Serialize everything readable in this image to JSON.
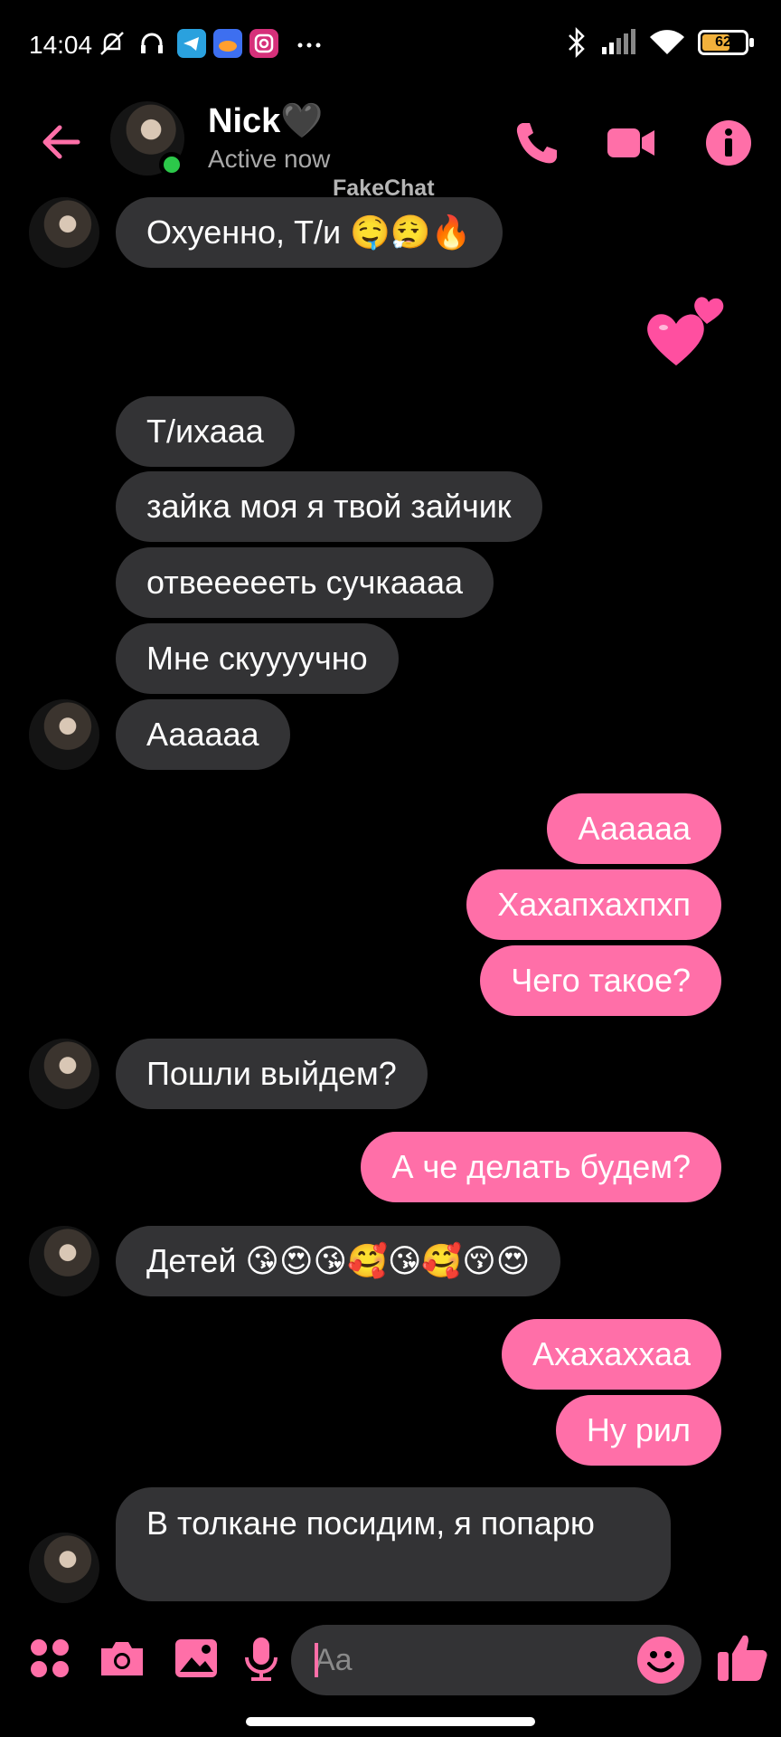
{
  "status_bar": {
    "time": "14:04",
    "battery": "62",
    "icons": [
      "muted-bell-icon",
      "headphones-icon",
      "telegram-icon",
      "cloud-app-icon",
      "instagram-icon",
      "more-dots-icon",
      "bluetooth-icon",
      "signal-icon",
      "wifi-icon",
      "battery-icon"
    ]
  },
  "header": {
    "name": "Nick🖤",
    "status": "Active now",
    "watermark": "FakeChat",
    "accent": "#ff6fa8",
    "icons": [
      "back-arrow-icon",
      "phone-icon",
      "video-icon",
      "info-icon"
    ]
  },
  "messages": [
    {
      "side": "in",
      "text": "Охуенно, Т/и 🤤😮‍💨🔥"
    },
    {
      "side": "out",
      "emoji": "💕"
    },
    {
      "side": "in",
      "text": "Т/ихааа"
    },
    {
      "side": "in",
      "text": "зайка моя я твой зайчик"
    },
    {
      "side": "in",
      "text": "отвеееееть сучкаааа"
    },
    {
      "side": "in",
      "text": "Мне скуууучно"
    },
    {
      "side": "in",
      "text": "Аааааа"
    },
    {
      "side": "out",
      "text": "Аааааа"
    },
    {
      "side": "out",
      "text": "Хахапхахпхп"
    },
    {
      "side": "out",
      "text": "Чего такое?"
    },
    {
      "side": "in",
      "text": "Пошли выйдем?"
    },
    {
      "side": "out",
      "text": "А че делать будем?"
    },
    {
      "side": "in",
      "text": "Детей 😘😍😘🥰😘🥰😚😍"
    },
    {
      "side": "out",
      "text": "Ахахаххаа"
    },
    {
      "side": "out",
      "text": "Ну рил"
    },
    {
      "side": "in",
      "text": "В толкане посидим, я попарю"
    }
  ],
  "composer": {
    "placeholder": "Aa",
    "icons": [
      "apps-grid-icon",
      "camera-icon",
      "gallery-icon",
      "microphone-icon",
      "emoji-icon",
      "thumbs-up-icon"
    ]
  }
}
